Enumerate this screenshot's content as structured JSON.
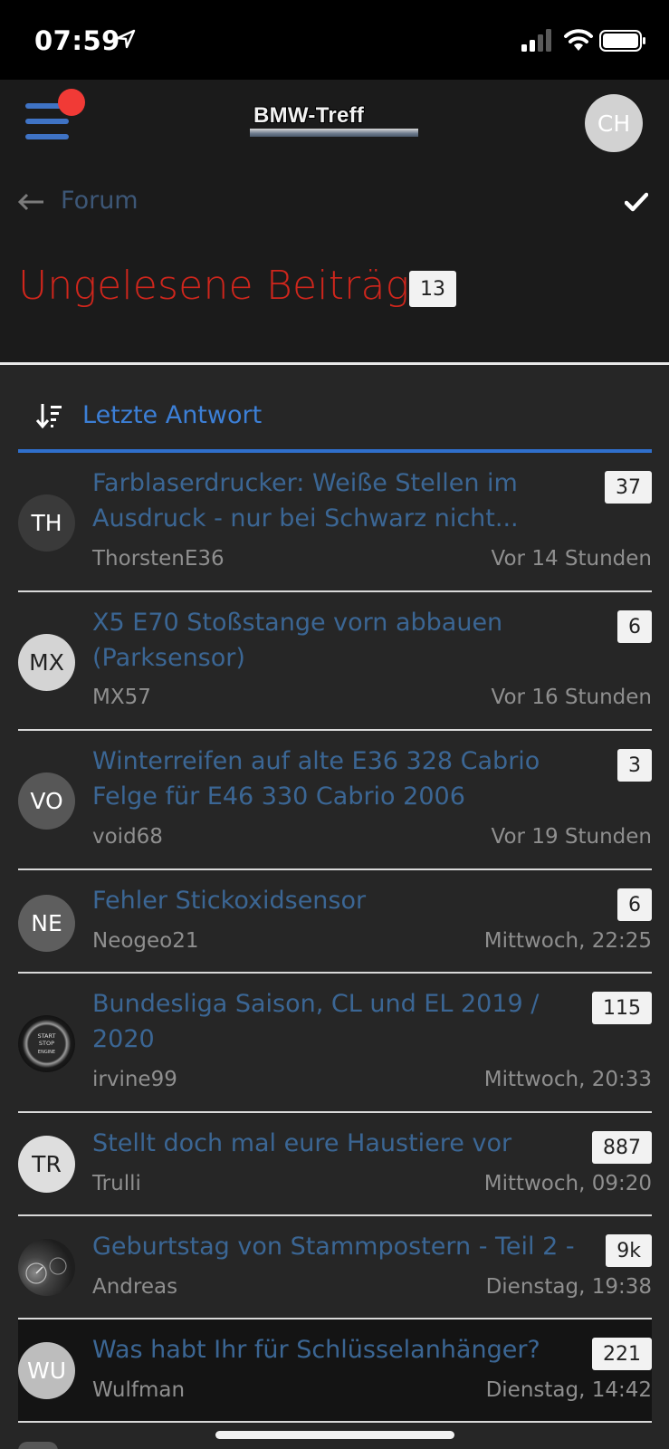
{
  "status_bar": {
    "time": "07:59"
  },
  "header": {
    "logo_text": "BMW-Treff",
    "user_initials": "CH",
    "back_label": "Forum",
    "page_title": "Ungelesene Beiträge",
    "unread_count": "13"
  },
  "sort": {
    "label": "Letzte Antwort"
  },
  "threads": [
    {
      "title": "Farblaserdrucker: Weiße Stellen im Ausdruck - nur bei Schwarz nicht...",
      "user": "ThorstenE36",
      "time": "Vor 14 Stunden",
      "count": "37",
      "initials": "TH",
      "avatar_color": "#3a3a3a"
    },
    {
      "title": "X5 E70 Stoßstange vorn abbauen (Parksensor)",
      "user": "MX57",
      "time": "Vor 16 Stunden",
      "count": "6",
      "initials": "MX",
      "avatar_color": "#d4d4d4"
    },
    {
      "title": "Winterreifen auf alte E36 328 Cabrio Felge für E46 330 Cabrio 2006",
      "user": "void68",
      "time": "Vor 19 Stunden",
      "count": "3",
      "initials": "VO",
      "avatar_color": "#575757"
    },
    {
      "title": "Fehler Stickoxidsensor",
      "user": "Neogeo21",
      "time": "Mittwoch, 22:25",
      "count": "6",
      "initials": "NE",
      "avatar_color": "#5e5e5e"
    },
    {
      "title": "Bundesliga Saison, CL und EL 2019 / 2020",
      "user": "irvine99",
      "time": "Mittwoch, 20:33",
      "count": "115",
      "avatar_image": "start-stop-button",
      "avatar_lines": [
        "START",
        "STOP",
        "ENGINE"
      ]
    },
    {
      "title": "Stellt doch mal eure Haustiere vor",
      "user": "Trulli",
      "time": "Mittwoch, 09:20",
      "count": "887",
      "initials": "TR",
      "avatar_color": "#dedede"
    },
    {
      "title": "Geburtstag von Stammpostern - Teil 2 -",
      "user": "Andreas",
      "time": "Dienstag, 19:38",
      "count": "9k",
      "avatar_image": "dashboard-photo"
    },
    {
      "title": "Was habt Ihr für Schlüsselanhänger?",
      "user": "Wulfman",
      "time": "Dienstag, 14:42",
      "count": "221",
      "initials": "WU",
      "avatar_color": "#bdbdbd",
      "highlight": true
    }
  ]
}
